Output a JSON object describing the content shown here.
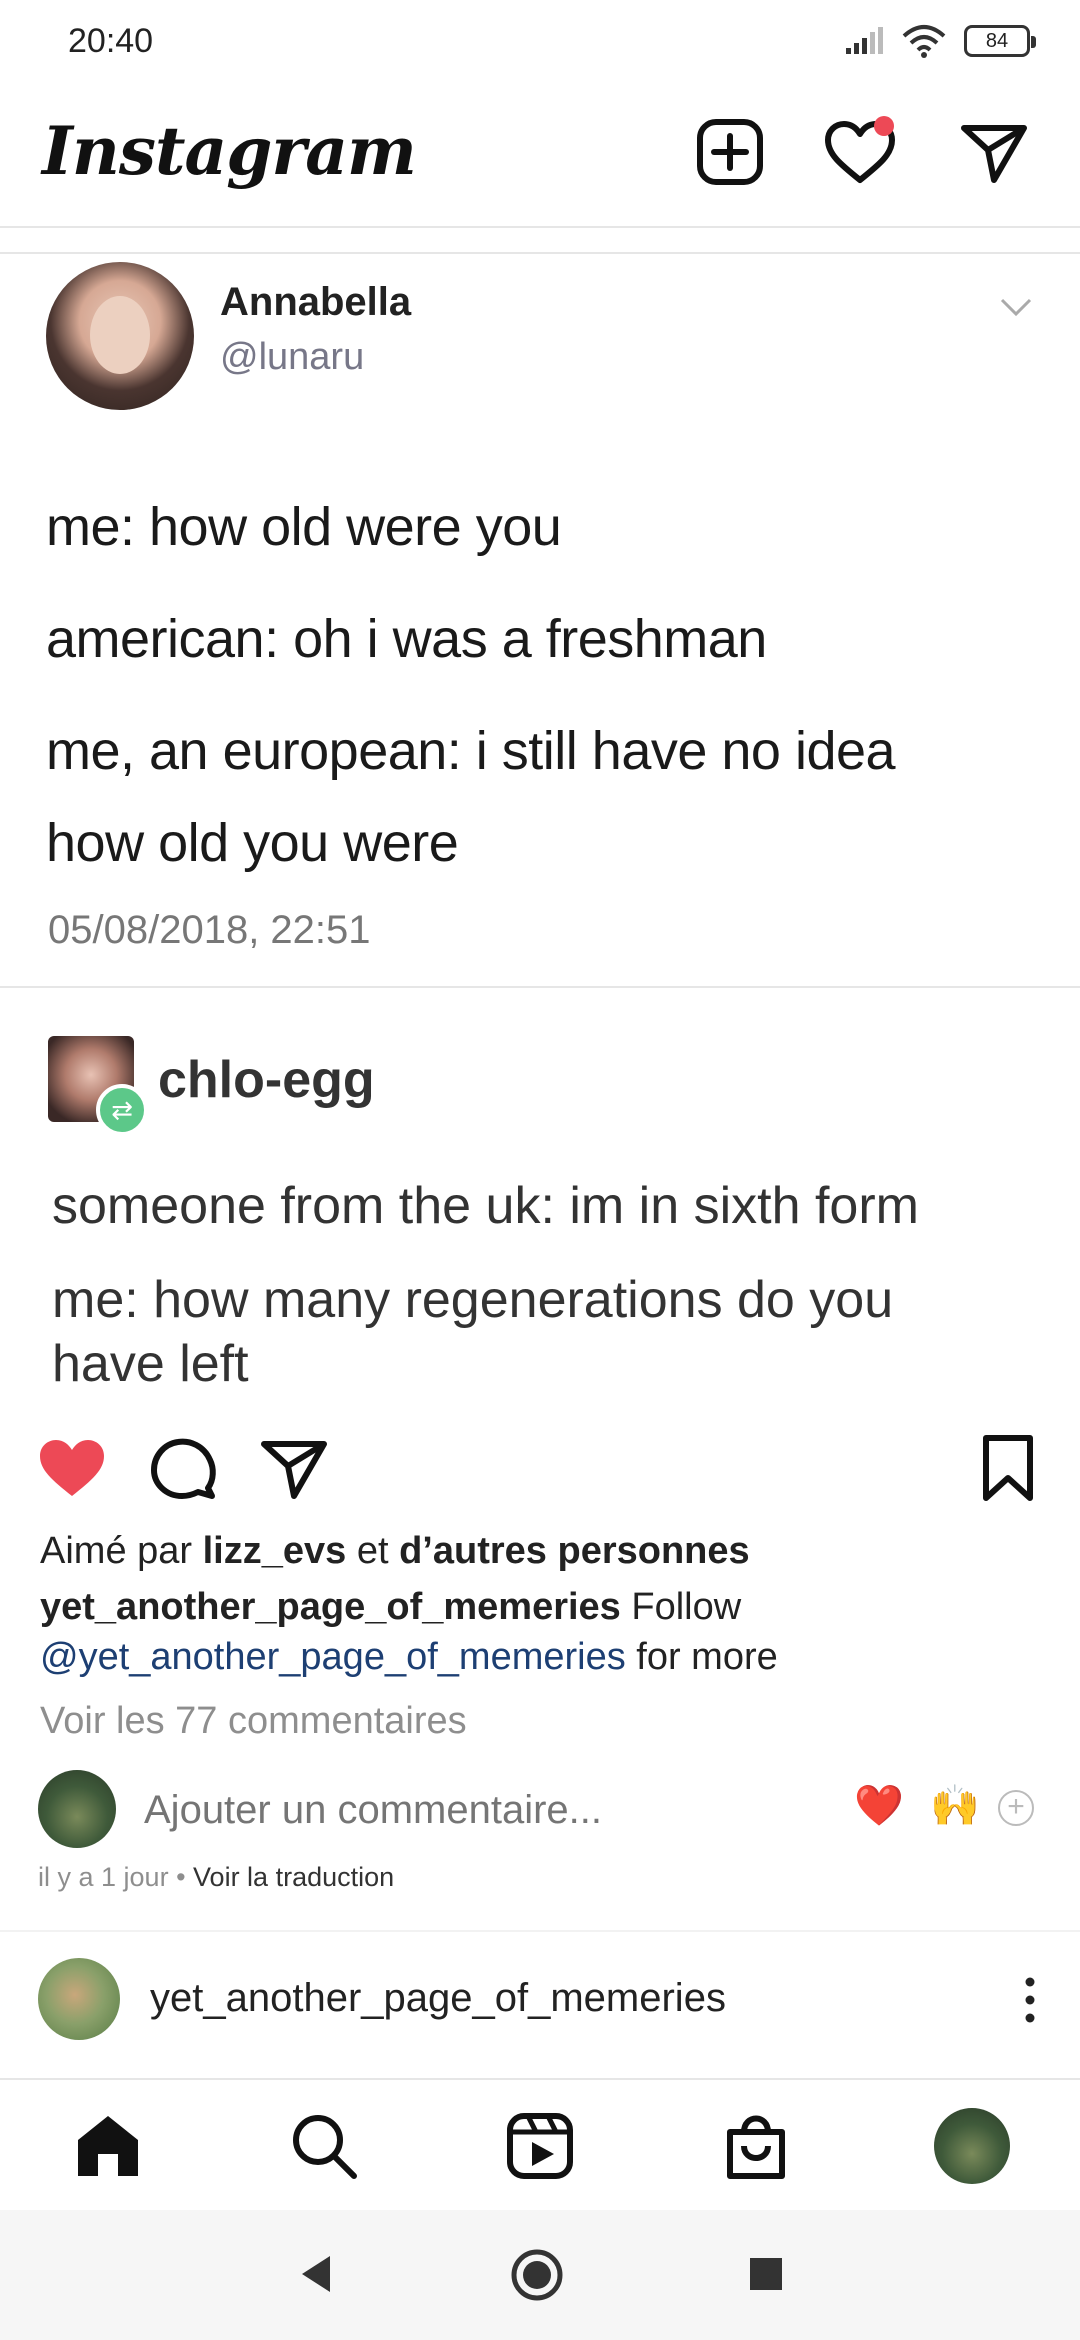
{
  "status_bar": {
    "time": "20:40",
    "battery": "84"
  },
  "header": {
    "logo": "Instagram",
    "icons": [
      "add-post-icon",
      "heart-notification-icon",
      "direct-message-icon"
    ],
    "notification_dot_color": "#ed4956"
  },
  "tweet": {
    "name": "Annabella",
    "handle": "@lunaru",
    "lines": [
      "me: how old were you",
      "american: oh i was a freshman",
      "me, an european: i still have no idea",
      "how old you were"
    ],
    "date": "05/08/2018, 22:51"
  },
  "tumblr": {
    "user": "chlo-egg",
    "lines": [
      "someone from the uk: im in sixth form",
      "me: how many regenerations do you",
      "have left"
    ],
    "badge_color": "#5cc889"
  },
  "post": {
    "liked": true,
    "like_color": "#ed4956",
    "likes_prefix": "Aimé par ",
    "likes_user": "lizz_evs",
    "likes_mid": " et ",
    "likes_others": "d’autres personnes",
    "caption_user": "yet_another_page_of_memeries",
    "caption_text": " Follow",
    "caption_mention": "@yet_another_page_of_memeries",
    "caption_more": " for more",
    "view_comments": "Voir les 77 commentaires",
    "comment_placeholder": "Ajouter un commentaire...",
    "quick_emojis": [
      "❤️",
      "🙌"
    ],
    "time_ago": "il y a 1 jour",
    "separator": " • ",
    "translate": "Voir la traduction"
  },
  "next_post": {
    "user": "yet_another_page_of_memeries"
  },
  "tabbar": {
    "items": [
      "home-icon",
      "search-icon",
      "reels-icon",
      "shop-icon",
      "profile-avatar"
    ]
  },
  "navbar": {
    "items": [
      "back-icon",
      "home-nav-icon",
      "recents-icon"
    ]
  }
}
